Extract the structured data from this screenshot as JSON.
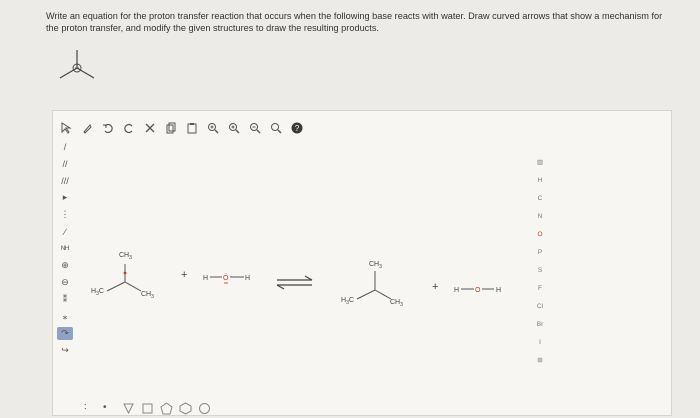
{
  "question": {
    "text": "Write an equation for the proton transfer reaction that occurs when the following base reacts with water. Draw curved arrows that show a mechanism for the proton transfer, and modify the given structures to draw the resulting products."
  },
  "top_toolbar": {
    "icons": [
      "select-icon",
      "lasso-icon",
      "undo-icon",
      "redo-icon",
      "delete-icon",
      "copy-icon",
      "paste-icon",
      "zoom-fit-icon",
      "zoom-in-icon",
      "zoom-out-icon",
      "zoom-reset-icon",
      "help-icon"
    ]
  },
  "left_toolbar": {
    "items": [
      {
        "name": "single-bond-tool",
        "glyph": "/"
      },
      {
        "name": "double-bond-tool",
        "glyph": "//"
      },
      {
        "name": "triple-bond-tool",
        "glyph": "///"
      },
      {
        "name": "wedge-bond-tool",
        "glyph": "▸"
      },
      {
        "name": "hash-bond-tool",
        "glyph": "⋮"
      },
      {
        "name": "wavy-bond-tool",
        "glyph": "∕"
      },
      {
        "name": "chain-tool",
        "glyph": "ᴺᴴ"
      },
      {
        "name": "positive-charge-tool",
        "glyph": "⊕"
      },
      {
        "name": "negative-charge-tool",
        "glyph": "⊖"
      },
      {
        "name": "lone-pair-tool",
        "glyph": "⁑"
      },
      {
        "name": "radical-tool",
        "glyph": "⁎"
      },
      {
        "name": "curved-arrow-tool",
        "glyph": "↷"
      },
      {
        "name": "half-arrow-tool",
        "glyph": "↪"
      }
    ]
  },
  "element_palette": {
    "items": [
      "H",
      "C",
      "N",
      "O",
      "P",
      "S",
      "F",
      "Cl",
      "Br",
      "I"
    ]
  },
  "reaction": {
    "reactant_top": "CH",
    "reactant_top_sub": "3",
    "reactant_left": "H",
    "reactant_left_sub": "3",
    "reactant_left_end": "C",
    "reactant_right": "CH",
    "reactant_right_sub": "3",
    "plus1": "+",
    "water_h1": "H",
    "water_o": "Ö",
    "water_h2": "H",
    "product_top": "CH",
    "product_top_sub": "3",
    "product_left": "H",
    "product_left_sub": "3",
    "product_left_end": "C",
    "product_right": "CH",
    "product_right_sub": "3",
    "plus2": "+",
    "product_h": "H",
    "product_o": "O",
    "product_h2": "H"
  },
  "colors": {
    "canvas_bg": "#f7f6f3",
    "page_bg": "#ecebe7",
    "oxygen": "#c0392b",
    "active_tool": "#8fa2c3"
  }
}
